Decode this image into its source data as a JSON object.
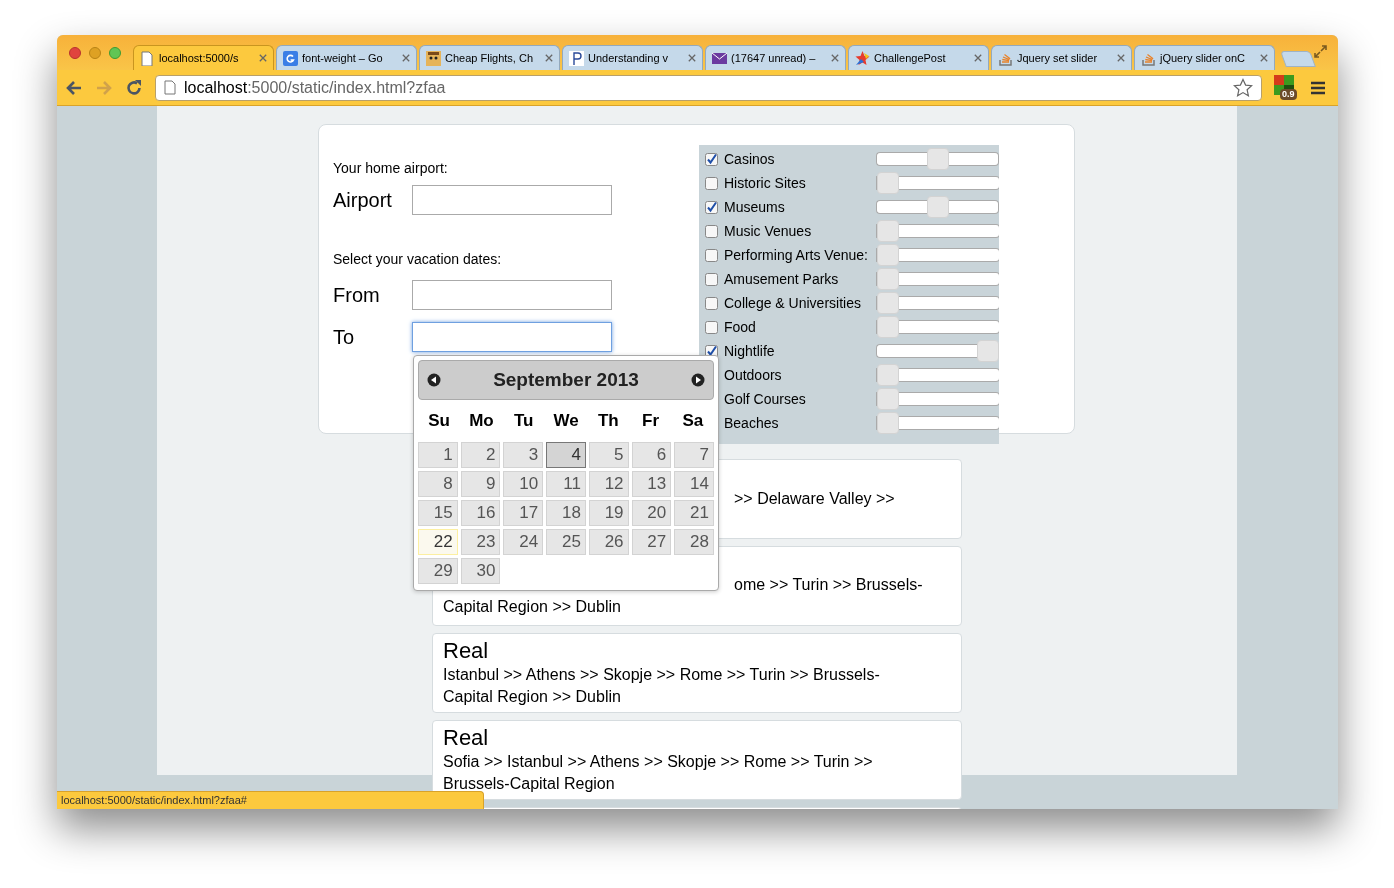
{
  "tabs": [
    {
      "title": "localhost:5000/s",
      "selected": true
    },
    {
      "title": "font-weight – Go",
      "selected": false
    },
    {
      "title": "Cheap Flights, Ch",
      "selected": false
    },
    {
      "title": "Understanding v",
      "selected": false
    },
    {
      "title": "(17647 unread) –",
      "selected": false
    },
    {
      "title": "ChallengePost",
      "selected": false
    },
    {
      "title": "Jquery set slider",
      "selected": false
    },
    {
      "title": "jQuery slider onC",
      "selected": false
    }
  ],
  "address": {
    "host": "localhost",
    "path": ":5000/static/index.html?zfaa"
  },
  "extension_badge": "0.9",
  "form": {
    "airport_prompt": "Your home airport:",
    "dates_prompt": "Select your vacation dates:",
    "fields": [
      {
        "label": "Airport",
        "focused": false
      },
      {
        "label": "From",
        "focused": false
      },
      {
        "label": "To",
        "focused": true
      }
    ]
  },
  "interests": [
    {
      "label": "Casinos",
      "checked": true,
      "level": 0.5
    },
    {
      "label": "Historic Sites",
      "checked": false,
      "level": 0
    },
    {
      "label": "Museums",
      "checked": true,
      "level": 0.5
    },
    {
      "label": "Music Venues",
      "checked": false,
      "level": 0
    },
    {
      "label": "Performing Arts Venue:",
      "checked": false,
      "level": 0
    },
    {
      "label": "Amusement Parks",
      "checked": false,
      "level": 0
    },
    {
      "label": "College & Universities",
      "checked": false,
      "level": 0
    },
    {
      "label": "Food",
      "checked": false,
      "level": 0
    },
    {
      "label": "Nightlife",
      "checked": true,
      "level": 1
    },
    {
      "label": "Outdoors",
      "level": 0
    },
    {
      "label": "Golf Courses",
      "level": 0
    },
    {
      "label": "Beaches",
      "level": 0
    }
  ],
  "calendar": {
    "title": "September 2013",
    "weekdays": [
      "Su",
      "Mo",
      "Tu",
      "We",
      "Th",
      "Fr",
      "Sa"
    ],
    "days": [
      {
        "d": "1",
        "selected": false,
        "today": false
      },
      {
        "d": "2",
        "selected": false,
        "today": false
      },
      {
        "d": "3",
        "selected": false,
        "today": false
      },
      {
        "d": "4",
        "selected": true,
        "today": false
      },
      {
        "d": "5",
        "selected": false,
        "today": false
      },
      {
        "d": "6",
        "selected": false,
        "today": false
      },
      {
        "d": "7",
        "selected": false,
        "today": false
      },
      {
        "d": "8",
        "selected": false,
        "today": false
      },
      {
        "d": "9",
        "selected": false,
        "today": false
      },
      {
        "d": "10",
        "selected": false,
        "today": false
      },
      {
        "d": "11",
        "selected": false,
        "today": false
      },
      {
        "d": "12",
        "selected": false,
        "today": false
      },
      {
        "d": "13",
        "selected": false,
        "today": false
      },
      {
        "d": "14",
        "selected": false,
        "today": false
      },
      {
        "d": "15",
        "selected": false,
        "today": false
      },
      {
        "d": "16",
        "selected": false,
        "today": false
      },
      {
        "d": "17",
        "selected": false,
        "today": false
      },
      {
        "d": "18",
        "selected": false,
        "today": false
      },
      {
        "d": "19",
        "selected": false,
        "today": false
      },
      {
        "d": "20",
        "selected": false,
        "today": false
      },
      {
        "d": "21",
        "selected": false,
        "today": false
      },
      {
        "d": "22",
        "selected": false,
        "today": true
      },
      {
        "d": "23",
        "selected": false,
        "today": false
      },
      {
        "d": "24",
        "selected": false,
        "today": false
      },
      {
        "d": "25",
        "selected": false,
        "today": false
      },
      {
        "d": "26",
        "selected": false,
        "today": false
      },
      {
        "d": "27",
        "selected": false,
        "today": false
      },
      {
        "d": "28",
        "selected": false,
        "today": false
      },
      {
        "d": "29",
        "selected": false,
        "today": false
      },
      {
        "d": "30",
        "selected": false,
        "today": false
      }
    ]
  },
  "routes": [
    {
      "lines": [
        ">> Delaware Valley >>"
      ]
    },
    {
      "lines": [
        "ome >> Turin >> Brussels-",
        "Capital Region >> Dublin"
      ]
    },
    {
      "title": "Real",
      "lines": [
        "Istanbul >> Athens >> Skopje >> Rome >> Turin >> Brussels-",
        "Capital Region >> Dublin"
      ]
    },
    {
      "title": "Real",
      "lines": [
        "Sofia >> Istanbul >> Athens >> Skopje >> Rome >> Turin >>",
        "Brussels-Capital Region"
      ]
    }
  ],
  "status_bar": "localhost:5000/static/index.html?zfaa#"
}
